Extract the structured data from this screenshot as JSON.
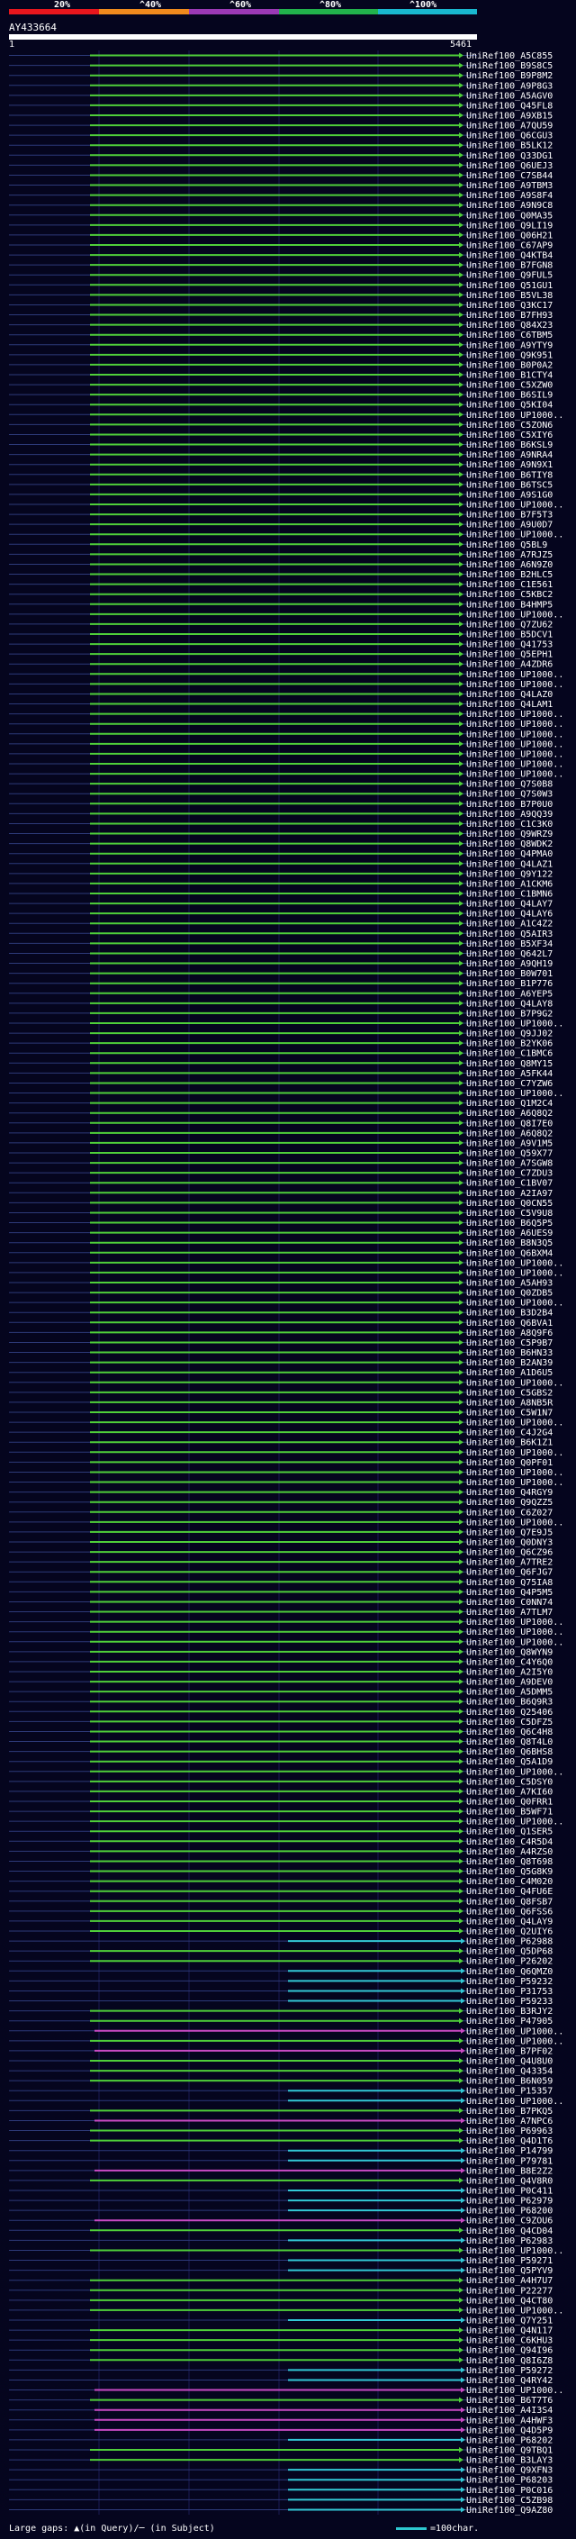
{
  "header": {
    "pct_labels": [
      "20%",
      "^40%",
      "^60%",
      "^80%",
      "^100%"
    ],
    "band_colors": [
      "#e8161d",
      "#f08a1d",
      "#9b39b6",
      "#22b24c",
      "#19b8cf"
    ],
    "query_id": "AY433664",
    "ruler_start": "1",
    "ruler_end": "5461"
  },
  "colors": {
    "background": "#05051e",
    "green_hit": "#4fcf3a",
    "cyan_hit": "#33c8d6",
    "magenta_hit": "#c94ac4",
    "thin_track": "#2d3a7a",
    "query_bar": "#ffffff"
  },
  "hits": [
    {
      "label": "UniRef100_A5C855",
      "kind": "g"
    },
    {
      "label": "UniRef100_B9S8C5",
      "kind": "g"
    },
    {
      "label": "UniRef100_B9P8M2",
      "kind": "g"
    },
    {
      "label": "UniRef100_A9P8G3",
      "kind": "g"
    },
    {
      "label": "UniRef100_A5AGV0",
      "kind": "g"
    },
    {
      "label": "UniRef100_Q45FL8",
      "kind": "g"
    },
    {
      "label": "UniRef100_A9XB15",
      "kind": "g"
    },
    {
      "label": "UniRef100_A7QU59",
      "kind": "g"
    },
    {
      "label": "UniRef100_Q6CGU3",
      "kind": "g"
    },
    {
      "label": "UniRef100_B5LK12",
      "kind": "g"
    },
    {
      "label": "UniRef100_Q33DG1",
      "kind": "g"
    },
    {
      "label": "UniRef100_Q6UEJ3",
      "kind": "g"
    },
    {
      "label": "UniRef100_C7SB44",
      "kind": "g"
    },
    {
      "label": "UniRef100_A9TBM3",
      "kind": "g"
    },
    {
      "label": "UniRef100_A9S8F4",
      "kind": "g"
    },
    {
      "label": "UniRef100_A9N9C8",
      "kind": "g"
    },
    {
      "label": "UniRef100_Q0MA35",
      "kind": "g"
    },
    {
      "label": "UniRef100_Q9LI19",
      "kind": "g"
    },
    {
      "label": "UniRef100_Q06H21",
      "kind": "g"
    },
    {
      "label": "UniRef100_C67AP9",
      "kind": "g"
    },
    {
      "label": "UniRef100_Q4KTB4",
      "kind": "g"
    },
    {
      "label": "UniRef100_B7FGN8",
      "kind": "g"
    },
    {
      "label": "UniRef100_Q9FUL5",
      "kind": "g"
    },
    {
      "label": "UniRef100_Q51GU1",
      "kind": "g"
    },
    {
      "label": "UniRef100_B5VL38",
      "kind": "g"
    },
    {
      "label": "UniRef100_Q3KC17",
      "kind": "g"
    },
    {
      "label": "UniRef100_B7FH93",
      "kind": "g"
    },
    {
      "label": "UniRef100_Q84X23",
      "kind": "g"
    },
    {
      "label": "UniRef100_C6TBM5",
      "kind": "g"
    },
    {
      "label": "UniRef100_A9YTY9",
      "kind": "g"
    },
    {
      "label": "UniRef100_Q9K951",
      "kind": "g"
    },
    {
      "label": "UniRef100_B0P0A2",
      "kind": "g"
    },
    {
      "label": "UniRef100_B1CTY4",
      "kind": "g"
    },
    {
      "label": "UniRef100_C5XZW0",
      "kind": "g"
    },
    {
      "label": "UniRef100_B6SIL9",
      "kind": "g"
    },
    {
      "label": "UniRef100_Q5KI04",
      "kind": "g"
    },
    {
      "label": "UniRef100_UP1000..",
      "kind": "g"
    },
    {
      "label": "UniRef100_C5ZON6",
      "kind": "g"
    },
    {
      "label": "UniRef100_C5XIY6",
      "kind": "g"
    },
    {
      "label": "UniRef100_B6KSL9",
      "kind": "g"
    },
    {
      "label": "UniRef100_A9NRA4",
      "kind": "g"
    },
    {
      "label": "UniRef100_A9N9X1",
      "kind": "g"
    },
    {
      "label": "UniRef100_B6TIY8",
      "kind": "g"
    },
    {
      "label": "UniRef100_B6TSC5",
      "kind": "g"
    },
    {
      "label": "UniRef100_A9S1G0",
      "kind": "g"
    },
    {
      "label": "UniRef100_UP1000..",
      "kind": "g"
    },
    {
      "label": "UniRef100_B7F5T3",
      "kind": "g"
    },
    {
      "label": "UniRef100_A9U0D7",
      "kind": "g"
    },
    {
      "label": "UniRef100_UP1000..",
      "kind": "g"
    },
    {
      "label": "UniRef100_Q5BL9",
      "kind": "g"
    },
    {
      "label": "UniRef100_A7RJZ5",
      "kind": "g"
    },
    {
      "label": "UniRef100_A6N9Z0",
      "kind": "g"
    },
    {
      "label": "UniRef100_B2HLC5",
      "kind": "g"
    },
    {
      "label": "UniRef100_C1E561",
      "kind": "g"
    },
    {
      "label": "UniRef100_C5KBC2",
      "kind": "g"
    },
    {
      "label": "UniRef100_B4HMP5",
      "kind": "g"
    },
    {
      "label": "UniRef100_UP1000..",
      "kind": "g"
    },
    {
      "label": "UniRef100_Q7ZU62",
      "kind": "g"
    },
    {
      "label": "UniRef100_B5DCV1",
      "kind": "g"
    },
    {
      "label": "UniRef100_Q41753",
      "kind": "g"
    },
    {
      "label": "UniRef100_Q5EPH1",
      "kind": "g"
    },
    {
      "label": "UniRef100_A4ZDR6",
      "kind": "g"
    },
    {
      "label": "UniRef100_UP1000..",
      "kind": "g"
    },
    {
      "label": "UniRef100_UP1000..",
      "kind": "g"
    },
    {
      "label": "UniRef100_Q4LAZ0",
      "kind": "g"
    },
    {
      "label": "UniRef100_Q4LAM1",
      "kind": "g"
    },
    {
      "label": "UniRef100_UP1000..",
      "kind": "g"
    },
    {
      "label": "UniRef100_UP1000..",
      "kind": "g"
    },
    {
      "label": "UniRef100_UP1000..",
      "kind": "g"
    },
    {
      "label": "UniRef100_UP1000..",
      "kind": "g"
    },
    {
      "label": "UniRef100_UP1000..",
      "kind": "g"
    },
    {
      "label": "UniRef100_UP1000..",
      "kind": "g"
    },
    {
      "label": "UniRef100_UP1000..",
      "kind": "g"
    },
    {
      "label": "UniRef100_Q7S0B8",
      "kind": "g"
    },
    {
      "label": "UniRef100_Q7S0W3",
      "kind": "g"
    },
    {
      "label": "UniRef100_B7P0U0",
      "kind": "g"
    },
    {
      "label": "UniRef100_A9QQ39",
      "kind": "g"
    },
    {
      "label": "UniRef100_C1C3K0",
      "kind": "g"
    },
    {
      "label": "UniRef100_Q9WRZ9",
      "kind": "g"
    },
    {
      "label": "UniRef100_Q8WDK2",
      "kind": "g"
    },
    {
      "label": "UniRef100_Q4PMA0",
      "kind": "g"
    },
    {
      "label": "UniRef100_Q4LAZ1",
      "kind": "g"
    },
    {
      "label": "UniRef100_Q9Y122",
      "kind": "g"
    },
    {
      "label": "UniRef100_A1CKM6",
      "kind": "g"
    },
    {
      "label": "UniRef100_C1BMN6",
      "kind": "g"
    },
    {
      "label": "UniRef100_Q4LAY7",
      "kind": "g"
    },
    {
      "label": "UniRef100_Q4LAY6",
      "kind": "g"
    },
    {
      "label": "UniRef100_A1C4Z2",
      "kind": "g"
    },
    {
      "label": "UniRef100_Q5AIR3",
      "kind": "g"
    },
    {
      "label": "UniRef100_B5XF34",
      "kind": "g"
    },
    {
      "label": "UniRef100_Q642L7",
      "kind": "g"
    },
    {
      "label": "UniRef100_A9QH19",
      "kind": "g"
    },
    {
      "label": "UniRef100_B0W701",
      "kind": "g"
    },
    {
      "label": "UniRef100_B1P776",
      "kind": "g"
    },
    {
      "label": "UniRef100_A6YEP5",
      "kind": "g"
    },
    {
      "label": "UniRef100_Q4LAY8",
      "kind": "g"
    },
    {
      "label": "UniRef100_B7P9G2",
      "kind": "g"
    },
    {
      "label": "UniRef100_UP1000..",
      "kind": "g"
    },
    {
      "label": "UniRef100_Q9JJ02",
      "kind": "g"
    },
    {
      "label": "UniRef100_B2YK06",
      "kind": "g"
    },
    {
      "label": "UniRef100_C1BMC6",
      "kind": "g"
    },
    {
      "label": "UniRef100_Q8MY15",
      "kind": "g"
    },
    {
      "label": "UniRef100_A5FK44",
      "kind": "g"
    },
    {
      "label": "UniRef100_C7YZW6",
      "kind": "g"
    },
    {
      "label": "UniRef100_UP1000..",
      "kind": "g"
    },
    {
      "label": "UniRef100_Q1M2C4",
      "kind": "g"
    },
    {
      "label": "UniRef100_A6Q8Q2",
      "kind": "g"
    },
    {
      "label": "UniRef100_Q8I7E0",
      "kind": "g"
    },
    {
      "label": "UniRef100_A6Q8Q2",
      "kind": "g"
    },
    {
      "label": "UniRef100_A9V1M5",
      "kind": "g"
    },
    {
      "label": "UniRef100_Q59X77",
      "kind": "g"
    },
    {
      "label": "UniRef100_A7SGW8",
      "kind": "g"
    },
    {
      "label": "UniRef100_C7ZDU3",
      "kind": "g"
    },
    {
      "label": "UniRef100_C1BV07",
      "kind": "g"
    },
    {
      "label": "UniRef100_A2IA97",
      "kind": "g"
    },
    {
      "label": "UniRef100_Q0CN55",
      "kind": "g"
    },
    {
      "label": "UniRef100_C5V9U8",
      "kind": "g"
    },
    {
      "label": "UniRef100_B6Q5P5",
      "kind": "g"
    },
    {
      "label": "UniRef100_A6UES9",
      "kind": "g"
    },
    {
      "label": "UniRef100_B8N3Q5",
      "kind": "g"
    },
    {
      "label": "UniRef100_Q6BXM4",
      "kind": "g"
    },
    {
      "label": "UniRef100_UP1000..",
      "kind": "g"
    },
    {
      "label": "UniRef100_UP1000..",
      "kind": "g"
    },
    {
      "label": "UniRef100_A5AH93",
      "kind": "g"
    },
    {
      "label": "UniRef100_Q0ZDB5",
      "kind": "g"
    },
    {
      "label": "UniRef100_UP1000..",
      "kind": "g"
    },
    {
      "label": "UniRef100_B3D2B4",
      "kind": "g"
    },
    {
      "label": "UniRef100_Q6BVA1",
      "kind": "g"
    },
    {
      "label": "UniRef100_A8Q9F6",
      "kind": "g"
    },
    {
      "label": "UniRef100_C5P9B7",
      "kind": "g"
    },
    {
      "label": "UniRef100_B6HN33",
      "kind": "g"
    },
    {
      "label": "UniRef100_B2AN39",
      "kind": "g"
    },
    {
      "label": "UniRef100_A1D6U5",
      "kind": "g"
    },
    {
      "label": "UniRef100_UP1000..",
      "kind": "g"
    },
    {
      "label": "UniRef100_C5GBS2",
      "kind": "g"
    },
    {
      "label": "UniRef100_A8NB5R",
      "kind": "g"
    },
    {
      "label": "UniRef100_C5W1N7",
      "kind": "g"
    },
    {
      "label": "UniRef100_UP1000..",
      "kind": "g"
    },
    {
      "label": "UniRef100_C4J2G4",
      "kind": "g"
    },
    {
      "label": "UniRef100_B6K1Z1",
      "kind": "g"
    },
    {
      "label": "UniRef100_UP1000..",
      "kind": "g"
    },
    {
      "label": "UniRef100_Q0PF01",
      "kind": "g"
    },
    {
      "label": "UniRef100_UP1000..",
      "kind": "g"
    },
    {
      "label": "UniRef100_UP1000..",
      "kind": "g"
    },
    {
      "label": "UniRef100_Q4RGY9",
      "kind": "g"
    },
    {
      "label": "UniRef100_Q9QZZ5",
      "kind": "g"
    },
    {
      "label": "UniRef100_C6Z027",
      "kind": "g"
    },
    {
      "label": "UniRef100_UP1000..",
      "kind": "g"
    },
    {
      "label": "UniRef100_Q7E9J5",
      "kind": "g"
    },
    {
      "label": "UniRef100_Q0DNY3",
      "kind": "g"
    },
    {
      "label": "UniRef100_Q6CZ96",
      "kind": "g"
    },
    {
      "label": "UniRef100_A7TRE2",
      "kind": "g"
    },
    {
      "label": "UniRef100_Q6FJG7",
      "kind": "g"
    },
    {
      "label": "UniRef100_Q75IA8",
      "kind": "g"
    },
    {
      "label": "UniRef100_Q4P5M5",
      "kind": "g"
    },
    {
      "label": "UniRef100_C0NN74",
      "kind": "g"
    },
    {
      "label": "UniRef100_A7TLM7",
      "kind": "g"
    },
    {
      "label": "UniRef100_UP1000..",
      "kind": "g"
    },
    {
      "label": "UniRef100_UP1000..",
      "kind": "g"
    },
    {
      "label": "UniRef100_UP1000..",
      "kind": "g"
    },
    {
      "label": "UniRef100_Q8WYN9",
      "kind": "g"
    },
    {
      "label": "UniRef100_C4Y6Q0",
      "kind": "g"
    },
    {
      "label": "UniRef100_A2I5Y0",
      "kind": "g"
    },
    {
      "label": "UniRef100_A9DEV0",
      "kind": "g"
    },
    {
      "label": "UniRef100_A5DMM5",
      "kind": "g"
    },
    {
      "label": "UniRef100_B6Q9R3",
      "kind": "g"
    },
    {
      "label": "UniRef100_Q25406",
      "kind": "g"
    },
    {
      "label": "UniRef100_C5DFZ5",
      "kind": "g"
    },
    {
      "label": "UniRef100_Q6C4H8",
      "kind": "g"
    },
    {
      "label": "UniRef100_Q8T4L0",
      "kind": "g"
    },
    {
      "label": "UniRef100_Q6BHS8",
      "kind": "g"
    },
    {
      "label": "UniRef100_Q5A1D9",
      "kind": "g"
    },
    {
      "label": "UniRef100_UP1000..",
      "kind": "g"
    },
    {
      "label": "UniRef100_C5DSY0",
      "kind": "g"
    },
    {
      "label": "UniRef100_A7KI60",
      "kind": "g"
    },
    {
      "label": "UniRef100_Q0FRR1",
      "kind": "g"
    },
    {
      "label": "UniRef100_B5WF71",
      "kind": "g"
    },
    {
      "label": "UniRef100_UP1000..",
      "kind": "g"
    },
    {
      "label": "UniRef100_Q1SER5",
      "kind": "g"
    },
    {
      "label": "UniRef100_C4R5D4",
      "kind": "g"
    },
    {
      "label": "UniRef100_A4RZS0",
      "kind": "g"
    },
    {
      "label": "UniRef100_Q8T698",
      "kind": "g"
    },
    {
      "label": "UniRef100_Q5G8K9",
      "kind": "g"
    },
    {
      "label": "UniRef100_C4M020",
      "kind": "g"
    },
    {
      "label": "UniRef100_Q4FU6E",
      "kind": "g"
    },
    {
      "label": "UniRef100_Q8FSB7",
      "kind": "g"
    },
    {
      "label": "UniRef100_Q6FSS6",
      "kind": "g"
    },
    {
      "label": "UniRef100_Q4LAY9",
      "kind": "g"
    },
    {
      "label": "UniRef100_Q2UIY6",
      "kind": "g"
    },
    {
      "label": "UniRef100_P62988",
      "kind": "c"
    },
    {
      "label": "UniRef100_Q5DP68",
      "kind": "g"
    },
    {
      "label": "UniRef100_P26202",
      "kind": "g"
    },
    {
      "label": "UniRef100_Q6QMZ0",
      "kind": "c"
    },
    {
      "label": "UniRef100_P59232",
      "kind": "c"
    },
    {
      "label": "UniRef100_P31753",
      "kind": "c"
    },
    {
      "label": "UniRef100_P59233",
      "kind": "c"
    },
    {
      "label": "UniRef100_B3RJY2",
      "kind": "g"
    },
    {
      "label": "UniRef100_P47905",
      "kind": "g"
    },
    {
      "label": "UniRef100_UP1000..",
      "kind": "m"
    },
    {
      "label": "UniRef100_UP1000..",
      "kind": "g"
    },
    {
      "label": "UniRef100_B7PF02",
      "kind": "m"
    },
    {
      "label": "UniRef100_Q4U8U0",
      "kind": "g"
    },
    {
      "label": "UniRef100_Q43354",
      "kind": "g"
    },
    {
      "label": "UniRef100_B6N059",
      "kind": "g"
    },
    {
      "label": "UniRef100_P15357",
      "kind": "c"
    },
    {
      "label": "UniRef100_UP1000..",
      "kind": "c"
    },
    {
      "label": "UniRef100_B7PKQ5",
      "kind": "g"
    },
    {
      "label": "UniRef100_A7NPC6",
      "kind": "m"
    },
    {
      "label": "UniRef100_P69963",
      "kind": "g"
    },
    {
      "label": "UniRef100_Q4D1T6",
      "kind": "g"
    },
    {
      "label": "UniRef100_P14799",
      "kind": "c"
    },
    {
      "label": "UniRef100_P79781",
      "kind": "c"
    },
    {
      "label": "UniRef100_B8E2Z2",
      "kind": "m"
    },
    {
      "label": "UniRef100_Q4V8R0",
      "kind": "g"
    },
    {
      "label": "UniRef100_P0C411",
      "kind": "c"
    },
    {
      "label": "UniRef100_P62979",
      "kind": "c"
    },
    {
      "label": "UniRef100_P68200",
      "kind": "c"
    },
    {
      "label": "UniRef100_C9ZOU6",
      "kind": "m"
    },
    {
      "label": "UniRef100_Q4CD04",
      "kind": "g"
    },
    {
      "label": "UniRef100_P62983",
      "kind": "c"
    },
    {
      "label": "UniRef100_UP1000..",
      "kind": "g"
    },
    {
      "label": "UniRef100_P59271",
      "kind": "c"
    },
    {
      "label": "UniRef100_Q5PYV9",
      "kind": "c"
    },
    {
      "label": "UniRef100_A4H7U7",
      "kind": "g"
    },
    {
      "label": "UniRef100_P22277",
      "kind": "g"
    },
    {
      "label": "UniRef100_Q4CT80",
      "kind": "g"
    },
    {
      "label": "UniRef100_UP1000..",
      "kind": "g"
    },
    {
      "label": "UniRef100_Q7Y251",
      "kind": "c"
    },
    {
      "label": "UniRef100_Q4N117",
      "kind": "g"
    },
    {
      "label": "UniRef100_C6KHU3",
      "kind": "g"
    },
    {
      "label": "UniRef100_Q94I96",
      "kind": "g"
    },
    {
      "label": "UniRef100_Q8I6Z8",
      "kind": "g"
    },
    {
      "label": "UniRef100_P59272",
      "kind": "c"
    },
    {
      "label": "UniRef100_Q4RY42",
      "kind": "c"
    },
    {
      "label": "UniRef100_UP1000..",
      "kind": "m"
    },
    {
      "label": "UniRef100_B6T7T6",
      "kind": "g"
    },
    {
      "label": "UniRef100_A4I3S4",
      "kind": "m"
    },
    {
      "label": "UniRef100_A4HWF3",
      "kind": "m"
    },
    {
      "label": "UniRef100_Q4D5P9",
      "kind": "m"
    },
    {
      "label": "UniRef100_P68202",
      "kind": "c"
    },
    {
      "label": "UniRef100_Q9TBQ1",
      "kind": "g"
    },
    {
      "label": "UniRef100_B3LAY3",
      "kind": "g"
    },
    {
      "label": "UniRef100_Q9XFN3",
      "kind": "c"
    },
    {
      "label": "UniRef100_P68203",
      "kind": "c"
    },
    {
      "label": "UniRef100_P0C016",
      "kind": "c"
    },
    {
      "label": "UniRef100_C5ZB98",
      "kind": "c"
    },
    {
      "label": "UniRef100_Q9AZ80",
      "kind": "c"
    }
  ],
  "legend": {
    "gaps_text": "Large gaps: ▲(in Query)/─ (in Subject)",
    "scale_text": "=100char."
  }
}
